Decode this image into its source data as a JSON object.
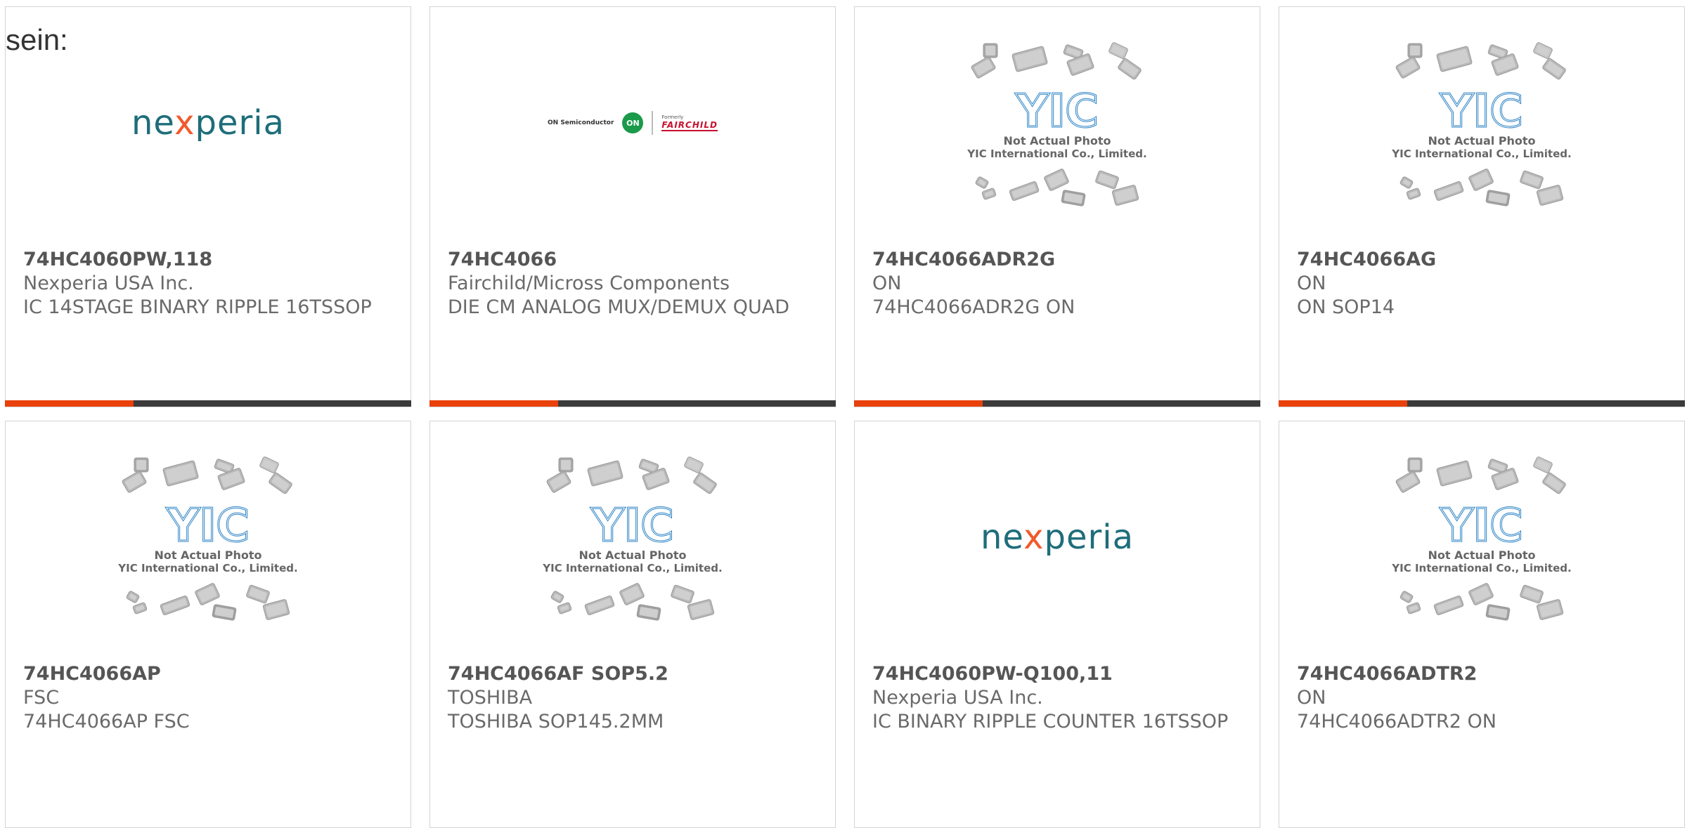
{
  "intro_text": "sein:",
  "accent_color": "#e8410b",
  "bar_color": "#3b3b3b",
  "placeholder": {
    "line1": "Not Actual Photo",
    "line2": "YIC International Co., Limited.",
    "logo_text": "YIC"
  },
  "logos": {
    "nexperia": "nexperia",
    "onsemi_text": "ON Semiconductor",
    "on_badge": "ON",
    "formerly": "Formerly",
    "fairchild": "FAIRCHILD"
  },
  "products": [
    {
      "part": "74HC4060PW,118",
      "manufacturer": "Nexperia USA Inc.",
      "description": "IC 14STAGE BINARY RIPPLE 16TSSOP",
      "image": "nexperia-logo"
    },
    {
      "part": "74HC4066",
      "manufacturer": "Fairchild/Micross Components",
      "description": "DIE CM ANALOG MUX/DEMUX QUAD",
      "image": "onsemi-fairchild-logo"
    },
    {
      "part": "74HC4066ADR2G",
      "manufacturer": "ON",
      "description": "74HC4066ADR2G ON",
      "image": "yic-placeholder"
    },
    {
      "part": "74HC4066AG",
      "manufacturer": "ON",
      "description": "ON SOP14",
      "image": "yic-placeholder"
    },
    {
      "part": "74HC4066AP",
      "manufacturer": "FSC",
      "description": "74HC4066AP FSC",
      "image": "yic-placeholder"
    },
    {
      "part": "74HC4066AF SOP5.2",
      "manufacturer": "TOSHIBA",
      "description": "TOSHIBA SOP145.2MM",
      "image": "yic-placeholder"
    },
    {
      "part": "74HC4060PW-Q100,11",
      "manufacturer": "Nexperia USA Inc.",
      "description": "IC BINARY RIPPLE COUNTER 16TSSOP",
      "image": "nexperia-logo"
    },
    {
      "part": "74HC4066ADTR2",
      "manufacturer": "ON",
      "description": "74HC4066ADTR2 ON",
      "image": "yic-placeholder"
    }
  ]
}
